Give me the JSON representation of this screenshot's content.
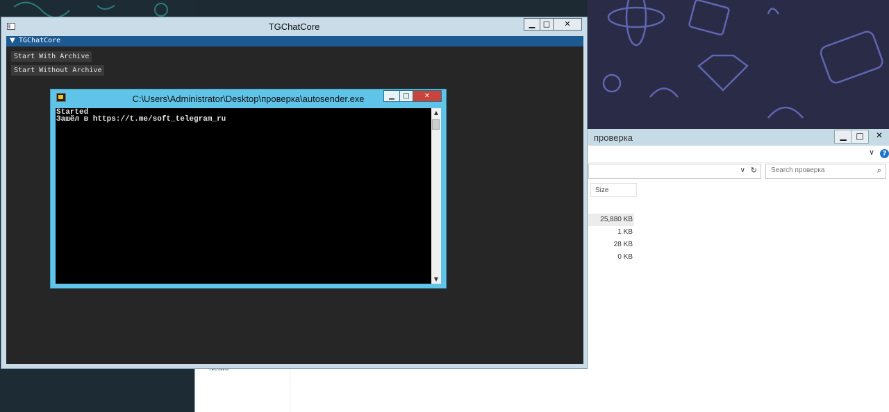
{
  "tg_window": {
    "title": "TGChatCore",
    "controls": {
      "minimize": "▁",
      "maximize": "□",
      "close": "✕"
    },
    "header": {
      "arrow": "▼",
      "label": "TGChatCore"
    },
    "buttons": [
      {
        "label": "Start With Archive"
      },
      {
        "label": "Start Without Archive"
      }
    ]
  },
  "console": {
    "title": "C:\\Users\\Administrator\\Desktop\\проверка\\autosender.exe",
    "controls": {
      "minimize": "▁",
      "maximize": "□",
      "close": "✕"
    },
    "lines": [
      "Started",
      "Зашёл в https://t.me/soft_telegram_ru"
    ],
    "scroll_up": "▲",
    "scroll_down": "▼"
  },
  "explorer": {
    "title": "проверка",
    "controls": {
      "minimize": "▁",
      "maximize": "□",
      "close": "✕"
    },
    "help_icon": "?",
    "ribbon_chevron": "∨",
    "address_dropdown": "∨",
    "refresh_icon": "↻",
    "search": {
      "placeholder": "Search проверка",
      "icon": "⌕"
    },
    "columns": {
      "size": "Size"
    },
    "sizes": [
      "25,880 KB",
      "1 KB",
      "28 KB",
      "0 KB"
    ],
    "nav_item": "Netwo"
  },
  "colors": {
    "tg_client_bg": "#262626",
    "tg_header_bg": "#1e5a92",
    "console_frame": "#5fc4e8",
    "console_close": "#c9443a"
  }
}
